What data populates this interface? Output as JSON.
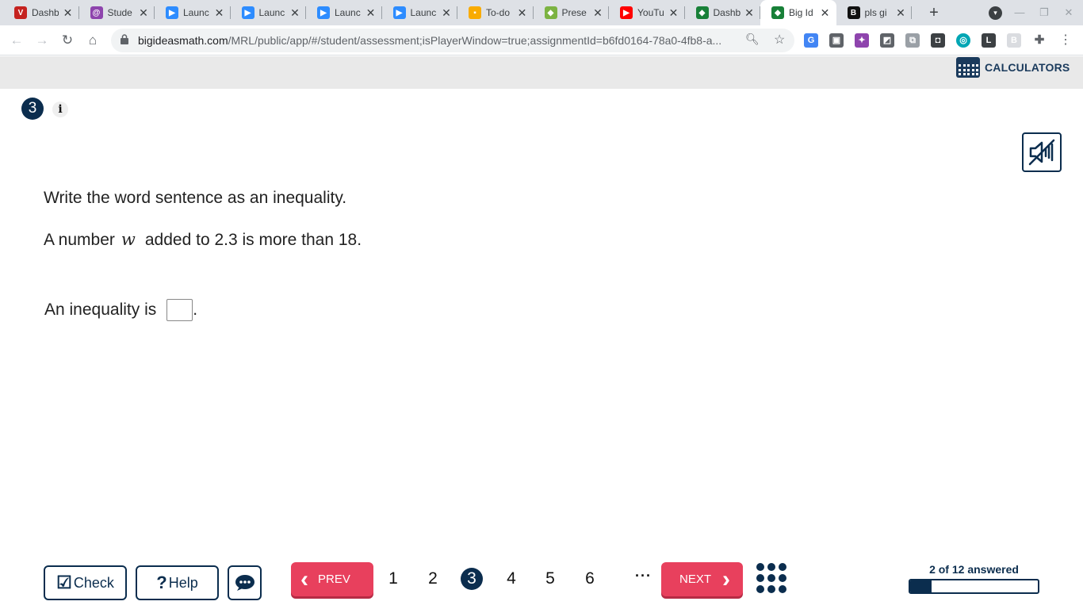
{
  "tabs": [
    {
      "title": "Dashb",
      "favicon": "red-v-icon",
      "color": "#c5221f",
      "glyph": "V"
    },
    {
      "title": "Stude",
      "favicon": "swirl-icon",
      "color": "#8e44ad",
      "glyph": "@"
    },
    {
      "title": "Launc",
      "favicon": "zoom-icon",
      "color": "#2d8cff",
      "glyph": "▶"
    },
    {
      "title": "Launc",
      "favicon": "zoom-icon",
      "color": "#2d8cff",
      "glyph": "▶"
    },
    {
      "title": "Launc",
      "favicon": "zoom-icon",
      "color": "#2d8cff",
      "glyph": "▶"
    },
    {
      "title": "Launc",
      "favicon": "zoom-icon",
      "color": "#2d8cff",
      "glyph": "▶"
    },
    {
      "title": "To-do",
      "favicon": "classroom-icon",
      "color": "#f9ab00",
      "glyph": "▪"
    },
    {
      "title": "Prese",
      "favicon": "pear-icon",
      "color": "#7cb342",
      "glyph": "◆"
    },
    {
      "title": "YouTu",
      "favicon": "youtube-icon",
      "color": "#ff0000",
      "glyph": "▶"
    },
    {
      "title": "Dashb",
      "favicon": "bim-icon",
      "color": "#188038",
      "glyph": "◆"
    },
    {
      "title": "Big Id",
      "favicon": "bim-icon",
      "color": "#188038",
      "glyph": "◆",
      "active": true
    },
    {
      "title": "pls gi",
      "favicon": "brainly-icon",
      "color": "#111111",
      "glyph": "B"
    }
  ],
  "url": {
    "host": "bigideasmath.com",
    "path": "/MRL/public/app/#/student/assessment;isPlayerWindow=true;assignmentId=b6fd0164-78a0-4fb8-a..."
  },
  "header": {
    "calculators_label": "CALCULATORS"
  },
  "question": {
    "number": "3",
    "info_label": "i",
    "instruction": "Write the word sentence as an inequality.",
    "sentence_before": "A number",
    "variable": "w",
    "sentence_after": "added to 2.3 is more than 18.",
    "answer_prompt": "An inequality is",
    "answer_end": ".",
    "answer_value": ""
  },
  "footer": {
    "check_label": "Check",
    "help_label": "Help",
    "prev_label": "PREV",
    "next_label": "NEXT",
    "pages": [
      "1",
      "2",
      "3",
      "4",
      "5",
      "6"
    ],
    "current_page": "3",
    "ellipsis": "···",
    "progress_label": "2 of 12 answered",
    "progress_fraction": 0.167
  },
  "colors": {
    "accent": "#e8405d",
    "brand": "#0b2d4e"
  }
}
